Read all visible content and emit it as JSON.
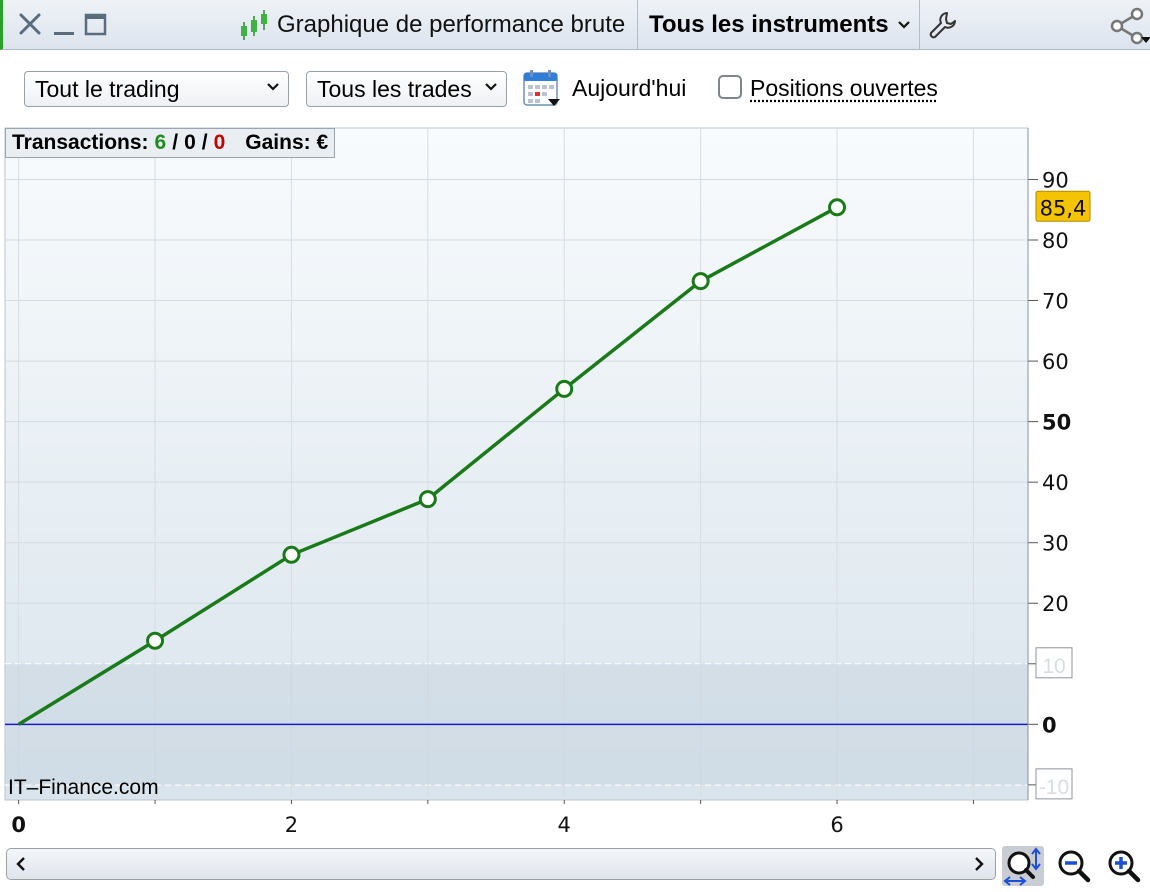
{
  "window": {
    "title": "Graphique de performance brute",
    "instrument_selector": "Tous les instruments"
  },
  "toolbar": {
    "trading_filter": "Tout le trading",
    "trades_filter": "Tous les trades",
    "date_label": "Aujourd'hui",
    "open_positions_label": "Positions ouvertes",
    "open_positions_checked": false
  },
  "stats": {
    "transactions_label": "Transactions:",
    "winning": "6",
    "slash1": "/",
    "neutral": "0",
    "slash2": "/",
    "losing": "0",
    "gains_label": "Gains: €"
  },
  "watermark": "IT–Finance.com",
  "colors": {
    "line": "#1a7a1a",
    "zero_line": "#1a1ad6",
    "last_value_bg": "#f5c400",
    "positive": "#1f8b1f",
    "negative": "#c00000"
  },
  "chart_data": {
    "type": "line",
    "x": [
      0,
      1,
      2,
      3,
      4,
      5,
      6
    ],
    "series": [
      {
        "values": [
          0,
          13.8,
          28,
          37.2,
          55.4,
          73.2,
          85.4
        ]
      }
    ],
    "xlim": [
      -0.1,
      7.4
    ],
    "ylim": [
      -12.5,
      98.5
    ],
    "x_ticks": [
      "0",
      "2",
      "4",
      "6"
    ],
    "y_ticks": [
      "90",
      "80",
      "70",
      "60",
      "50",
      "40",
      "30",
      "20",
      "10",
      "0",
      "-10"
    ],
    "last_value_label": "85,4",
    "band": [
      -10,
      10
    ],
    "grid": true
  },
  "icons": {
    "close": "close-icon",
    "minimize": "minimize-icon",
    "maximize": "maximize-icon",
    "title": "candlestick-chart-icon",
    "settings": "wrench-icon",
    "share": "share-icon",
    "calendar": "calendar-icon",
    "zoom_fit": "zoom-fit-icon",
    "zoom_out": "zoom-out-icon",
    "zoom_in": "zoom-in-icon"
  }
}
